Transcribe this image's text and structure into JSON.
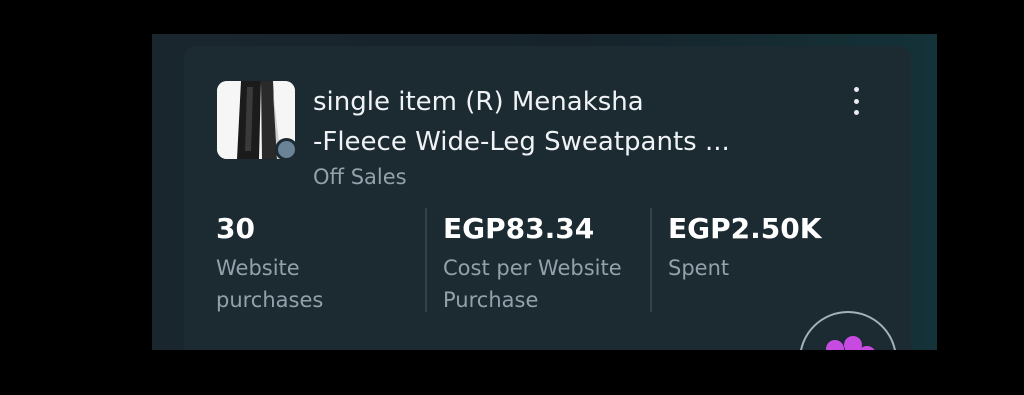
{
  "campaign": {
    "title_line1": "single item (R) Menaksha",
    "title_line2": "-Fleece Wide-Leg Sweatpants ...",
    "status": "Off",
    "category": "Sales",
    "status_color": "#6a8397"
  },
  "metrics": [
    {
      "value": "30",
      "label_line1": "Website",
      "label_line2": "purchases"
    },
    {
      "value": "EGP83.34",
      "label_line1": "Cost per Website",
      "label_line2": "Purchase"
    },
    {
      "value": "EGP2.50K",
      "label_line1": "Spent",
      "label_line2": ""
    }
  ],
  "icons": {
    "more": "more-vertical-icon",
    "fab": "flower-icon"
  },
  "colors": {
    "card_bg": "#1c2a32",
    "text_primary": "#ffffff",
    "text_secondary": "#93a1ab",
    "fab_accent": "#c74be0"
  }
}
